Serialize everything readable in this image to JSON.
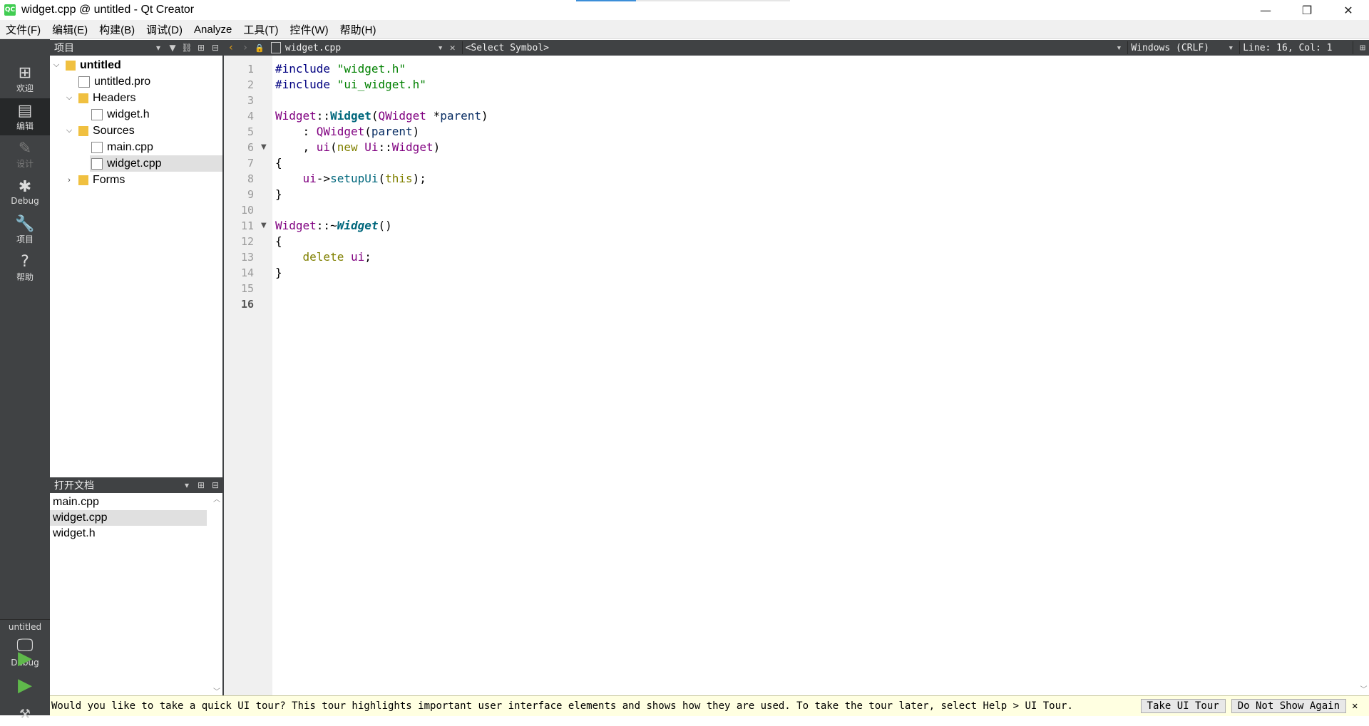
{
  "window": {
    "title": "widget.cpp @ untitled - Qt Creator",
    "logo": "QC",
    "minimize": "—",
    "restore": "❐",
    "close": "✕",
    "progress": 0.28
  },
  "menu": [
    "文件(F)",
    "编辑(E)",
    "构建(B)",
    "调试(D)",
    "Analyze",
    "工具(T)",
    "控件(W)",
    "帮助(H)"
  ],
  "modes": [
    {
      "label": "欢迎",
      "icon": "grid-icon"
    },
    {
      "label": "编辑",
      "icon": "edit-doc-icon"
    },
    {
      "label": "设计",
      "icon": "pencil-icon"
    },
    {
      "label": "Debug",
      "icon": "bug-icon"
    },
    {
      "label": "项目",
      "icon": "wrench-icon"
    },
    {
      "label": "帮助",
      "icon": "help-icon"
    }
  ],
  "kit": {
    "project": "untitled",
    "config": "Debug"
  },
  "project_panel": {
    "title": "项目"
  },
  "tree": [
    {
      "label": "untitled",
      "bold": true
    },
    {
      "label": "untitled.pro"
    },
    {
      "label": "Headers"
    },
    {
      "label": "widget.h"
    },
    {
      "label": "Sources"
    },
    {
      "label": "main.cpp"
    },
    {
      "label": "widget.cpp",
      "selected": true
    },
    {
      "label": "Forms"
    }
  ],
  "open_docs": {
    "title": "打开文档",
    "items": [
      "main.cpp",
      "widget.cpp",
      "widget.h"
    ],
    "selected": "widget.cpp"
  },
  "editor_bar": {
    "file": "widget.cpp",
    "symbol": "<Select Symbol>",
    "line_ending": "Windows (CRLF)",
    "position": "Line: 16, Col: 1"
  },
  "editor": {
    "line_numbers": [
      "1",
      "2",
      "3",
      "4",
      "5",
      "6",
      "7",
      "8",
      "9",
      "10",
      "11",
      "12",
      "13",
      "14",
      "15",
      "16"
    ],
    "current_line": "16"
  },
  "infobar": {
    "message": "Would you like to take a quick UI tour? This tour highlights important user interface elements and shows how they are used. To take the tour later, select Help > UI Tour.",
    "take_tour": "Take UI Tour",
    "dont_show": "Do Not Show Again",
    "close": "✕"
  }
}
